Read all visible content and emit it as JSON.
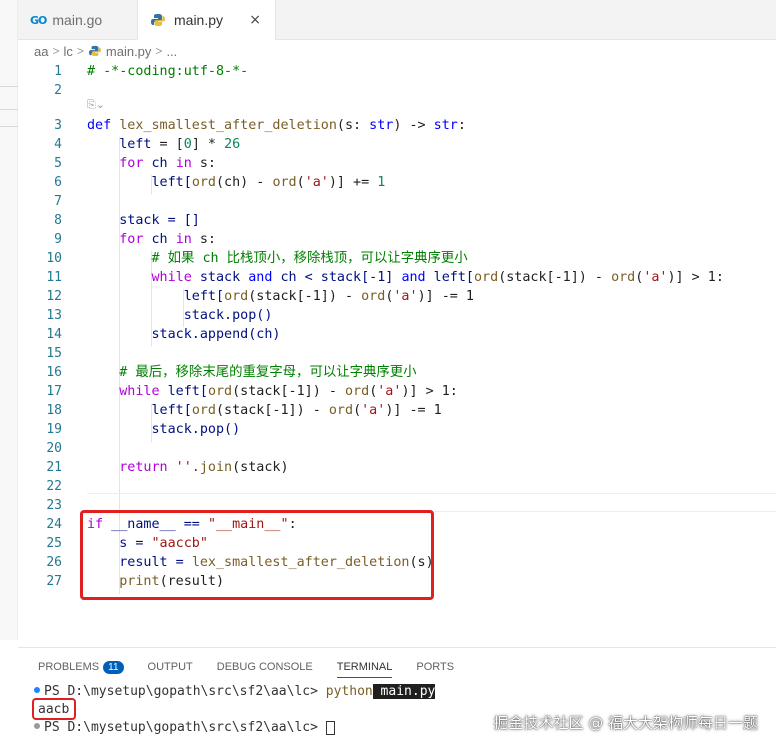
{
  "tabs": [
    {
      "icon": "go-file-icon",
      "label": "main.go",
      "glyph": "GO"
    },
    {
      "icon": "python-file-icon",
      "label": "main.py",
      "close": "×"
    }
  ],
  "breadcrumb": {
    "parts": [
      "aa",
      "lc",
      "main.py",
      "..."
    ],
    "sep": ">"
  },
  "codelens": "⎘⌄",
  "code": {
    "l1": "# -*-coding:utf-8-*-",
    "def": "def",
    "fname": "lex_smallest_after_deletion",
    "params": "(s: ",
    "str": "str",
    "ret": ") -> ",
    "str2": "str",
    "colon": ":",
    "l4a": "left",
    "l4b": " = [",
    "l4c": "0",
    "l4d": "] * ",
    "l4e": "26",
    "for": "for",
    "ch": " ch ",
    "in": "in",
    "s": " s:",
    "l6a": "left[",
    "ord": "ord",
    "l6b": "(ch) - ",
    "ord2": "ord",
    "l6c": "(",
    "a": "'a'",
    "l6d": ")] += ",
    "one": "1",
    "l8": "stack = []",
    "l10": "# 如果 ch 比栈顶小，移除栈顶，可以让字典序更小",
    "while": "while",
    "and": "and",
    "l11a": " stack ",
    "l11b": " ch < stack[-1] ",
    "l11c": " left[",
    "l11d": "(stack[-1]) - ",
    "l11e": ")] > 1:",
    "l12a": "left[",
    "l12b": "(stack[-1]) - ",
    "l12c": ")] -= 1",
    "l13": "stack.pop()",
    "l14": "stack.append(ch)",
    "l16": "# 最后，移除末尾的重复字母，可以让字典序更小",
    "l17a": " left[",
    "l17b": "(stack[-1]) - ",
    "l17c": ")] > 1:",
    "l18a": "left[",
    "l18b": "(stack[-1]) - ",
    "l18c": ")] -= 1",
    "l19": "stack.pop()",
    "return": "return",
    "l21a": " ''.",
    "join": "join",
    "l21b": "(stack)",
    "if": "if",
    "l24a": " __name__ == ",
    "l24b": "\"__main__\"",
    "l24c": ":",
    "l25a": "s = ",
    "l25b": "\"aaccb\"",
    "l26a": "result = ",
    "l26b": "lex_smallest_after_deletion",
    "l26c": "(s)",
    "print": "print",
    "l27": "(result)",
    "line_numbers": [
      "1",
      "2",
      "3",
      "4",
      "5",
      "6",
      "7",
      "8",
      "9",
      "10",
      "11",
      "12",
      "13",
      "14",
      "15",
      "16",
      "17",
      "18",
      "19",
      "20",
      "21",
      "22",
      "23",
      "24",
      "25",
      "26",
      "27"
    ]
  },
  "panel": {
    "tabs": [
      "PROBLEMS",
      "OUTPUT",
      "DEBUG CONSOLE",
      "TERMINAL",
      "PORTS"
    ],
    "problems_count": "11",
    "terminal": {
      "prompt1": "PS D:\\mysetup\\gopath\\src\\sf2\\aa\\lc> ",
      "cmd": "python",
      "arg": " main.py",
      "output": "aacb",
      "prompt2": "PS D:\\mysetup\\gopath\\src\\sf2\\aa\\lc> "
    }
  },
  "watermark": "掘金技术社区 @ 福大大架构师每日一题",
  "colors": {
    "accent": "#005fb8",
    "highlight": "#e02020",
    "keyword": "#0000ff",
    "comment": "#008000"
  }
}
